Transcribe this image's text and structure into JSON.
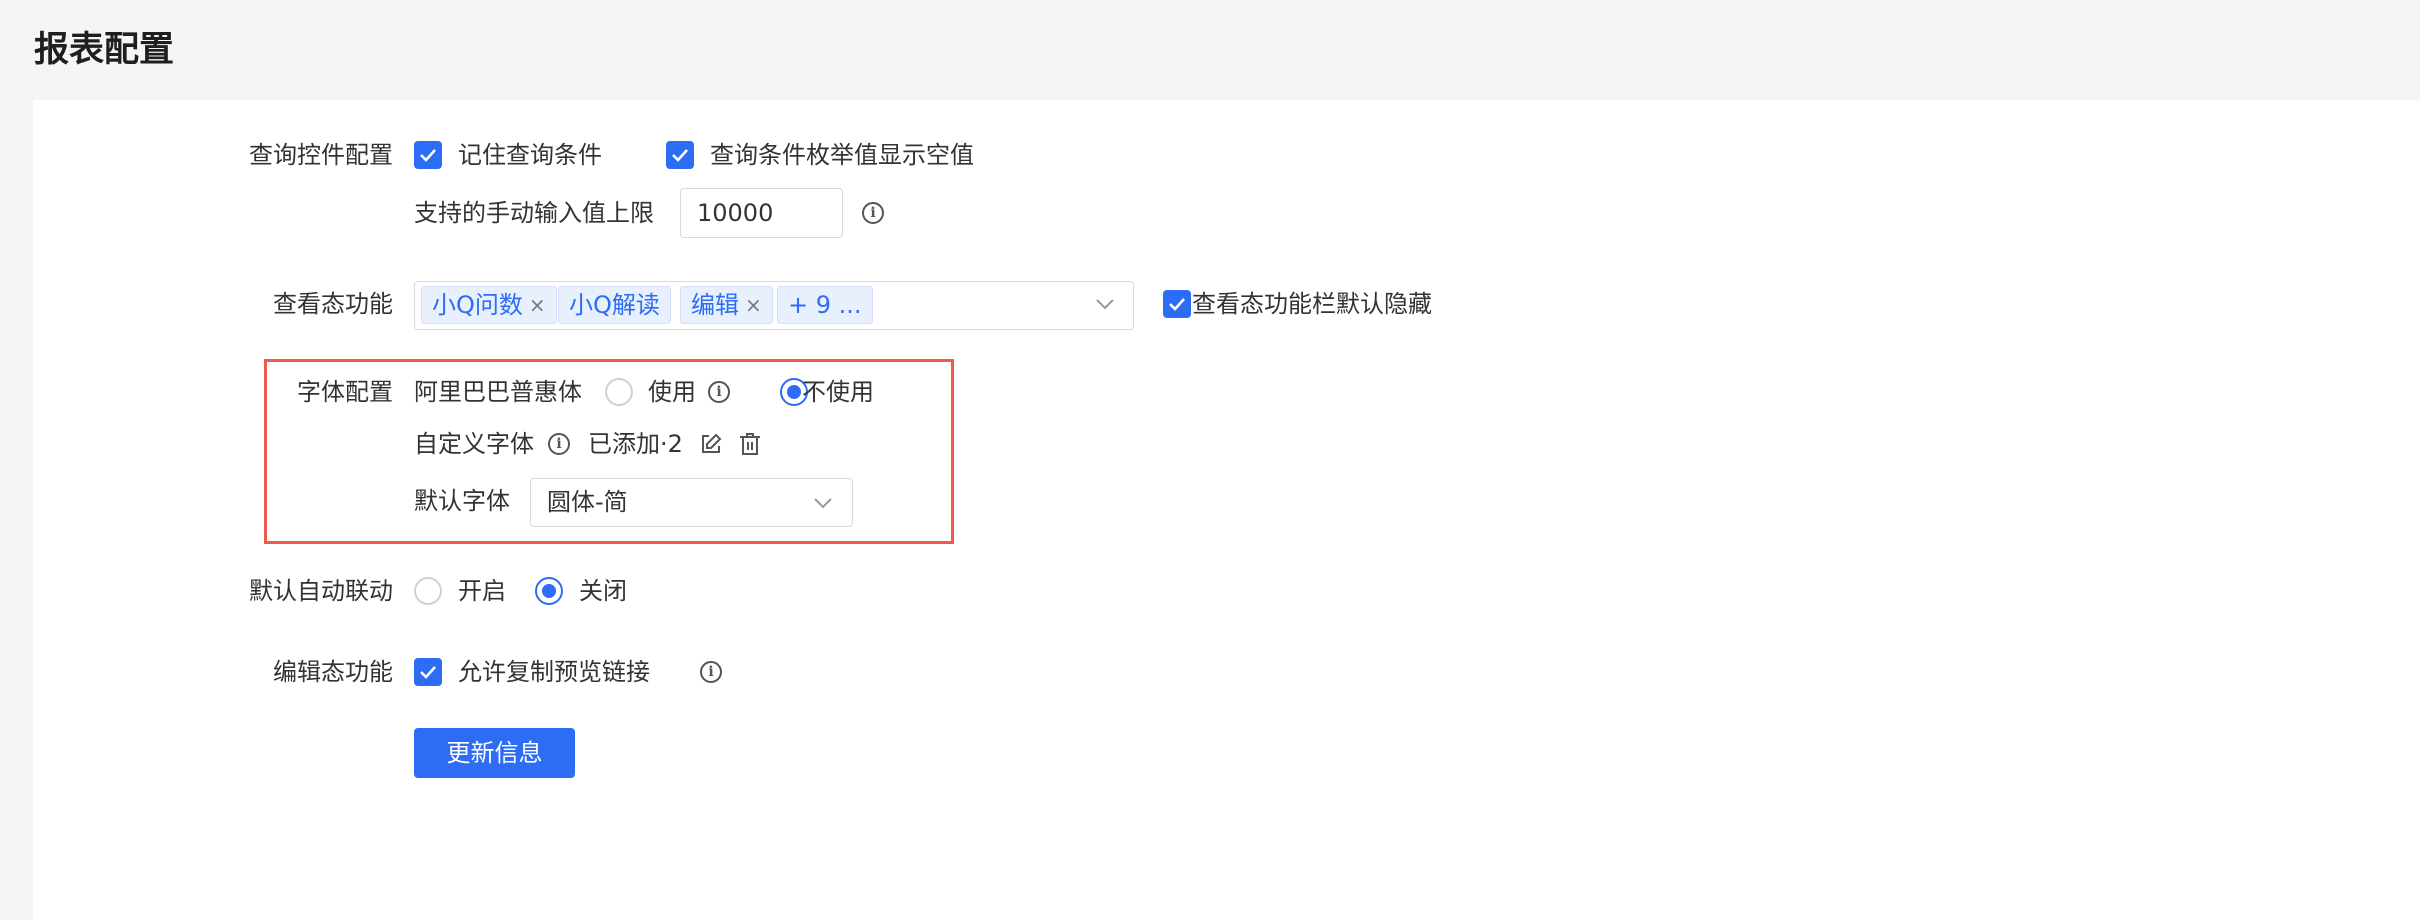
{
  "page": {
    "title": "报表配置"
  },
  "query_control": {
    "label": "查询控件配置",
    "remember_conditions": {
      "label": "记住查询条件",
      "checked": true
    },
    "show_empty_enum": {
      "label": "查询条件枚举值显示空值",
      "checked": true
    },
    "max_manual_input": {
      "label": "支持的手动输入值上限",
      "value": "10000"
    }
  },
  "view_features": {
    "label": "查看态功能",
    "tags": [
      {
        "label": "小Q问数",
        "closable": true
      },
      {
        "label": "小Q解读",
        "closable": false
      },
      {
        "label": "编辑",
        "closable": true
      },
      {
        "label": "+ 9 ...",
        "closable": false
      }
    ],
    "hide_toolbar_default": {
      "label": "查看态功能栏默认隐藏",
      "checked": true
    }
  },
  "font_config": {
    "label": "字体配置",
    "alibaba_font": {
      "label": "阿里巴巴普惠体",
      "options": [
        "使用",
        "不使用"
      ],
      "selected": "不使用"
    },
    "custom_font": {
      "label": "自定义字体",
      "status": "已添加·2"
    },
    "default_font": {
      "label": "默认字体",
      "value": "圆体-简"
    }
  },
  "auto_link": {
    "label": "默认自动联动",
    "options": [
      "开启",
      "关闭"
    ],
    "selected": "关闭"
  },
  "edit_features": {
    "label": "编辑态功能",
    "allow_copy_preview": {
      "label": "允许复制预览链接",
      "checked": true
    }
  },
  "actions": {
    "update_label": "更新信息"
  },
  "colors": {
    "accent": "#2d6cf5",
    "highlight": "#ef5a4e",
    "panel": "#ffffff",
    "background": "#f5f5f5"
  }
}
